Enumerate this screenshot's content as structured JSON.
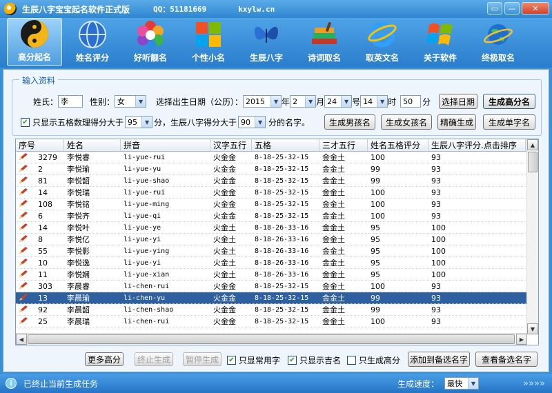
{
  "window": {
    "title": "生辰八字宝宝起名软件正式版",
    "qq": "QQ：51181669",
    "site": "kxylw.cn"
  },
  "toolbar": [
    {
      "label": "高分起名",
      "icon": "yin-yang-icon",
      "active": true
    },
    {
      "label": "姓名评分",
      "icon": "globe-icon"
    },
    {
      "label": "好听靓名",
      "icon": "hexagon-flower-icon"
    },
    {
      "label": "个性小名",
      "icon": "windows-logo-icon"
    },
    {
      "label": "生辰八字",
      "icon": "butterfly-icon"
    },
    {
      "label": "诗词取名",
      "icon": "books-icon"
    },
    {
      "label": "取英文名",
      "icon": "ie-globe-icon"
    },
    {
      "label": "关于软件",
      "icon": "vista-logo-icon"
    },
    {
      "label": "终极取名",
      "icon": "earth-orbit-icon"
    }
  ],
  "form": {
    "group_title": "输入资料",
    "surname_label": "姓氏：",
    "surname_value": "李",
    "gender_label": "性别：",
    "gender_value": "女",
    "date_label": "选择出生日期（公历）：",
    "year": "2015",
    "year_unit": "年",
    "month": "2",
    "month_unit": "月",
    "day": "24",
    "day_unit": "号",
    "hour": "14",
    "hour_unit": "时",
    "minute": "50",
    "minute_unit": "分",
    "pick_date_btn": "选择日期",
    "gen_high_btn": "生成高分名",
    "filter_label1": "只显示五格数理得分大于",
    "wuge_min": "95",
    "filter_label2": "分，生辰八字得分大于",
    "bazi_min": "90",
    "filter_label3": "分的名字。",
    "boy_btn": "生成男孩名",
    "girl_btn": "生成女孩名",
    "precise_btn": "精确生成",
    "single_btn": "生成单字名"
  },
  "table": {
    "columns": [
      "序号",
      "姓名",
      "拼音",
      "汉字五行",
      "五格",
      "三才五行",
      "姓名五格评分",
      "生辰八字评分.点击排序"
    ],
    "rows": [
      [
        "3279",
        "李悦睿",
        "li-yue-rui",
        "火金金",
        "8-18-25-32-15",
        "金金土",
        "100",
        "93"
      ],
      [
        "2",
        "李悦瑜",
        "li-yue-yu",
        "火金金",
        "8-18-25-32-15",
        "金金土",
        "99",
        "93"
      ],
      [
        "81",
        "李悦韶",
        "li-yue-shao",
        "火金金",
        "8-18-25-32-15",
        "金金土",
        "99",
        "93"
      ],
      [
        "14",
        "李悦瑞",
        "li-yue-rui",
        "火金金",
        "8-18-25-32-15",
        "金金土",
        "100",
        "93"
      ],
      [
        "108",
        "李悦铭",
        "li-yue-ming",
        "火金金",
        "8-18-25-32-15",
        "金金土",
        "100",
        "93"
      ],
      [
        "6",
        "李悦齐",
        "li-yue-qi",
        "火金金",
        "8-18-25-32-15",
        "金金土",
        "100",
        "93"
      ],
      [
        "14",
        "李悦叶",
        "li-yue-ye",
        "火金土",
        "8-18-26-33-16",
        "金金土",
        "95",
        "100"
      ],
      [
        "8",
        "李悦亿",
        "li-yue-yi",
        "火金土",
        "8-18-26-33-16",
        "金金土",
        "95",
        "100"
      ],
      [
        "55",
        "李悦影",
        "li-yue-ying",
        "火金土",
        "8-18-26-33-16",
        "金金土",
        "95",
        "100"
      ],
      [
        "10",
        "李悦逸",
        "li-yue-yi",
        "火金土",
        "8-18-26-33-16",
        "金金土",
        "95",
        "100"
      ],
      [
        "11",
        "李悦娴",
        "li-yue-xian",
        "火金土",
        "8-18-26-33-16",
        "金金土",
        "95",
        "100"
      ],
      [
        "303",
        "李晨睿",
        "li-chen-rui",
        "火金金",
        "8-18-25-32-15",
        "金金土",
        "100",
        "93"
      ],
      [
        "13",
        "李晨瑜",
        "li-chen-yu",
        "火金金",
        "8-18-25-32-15",
        "金金土",
        "99",
        "93"
      ],
      [
        "92",
        "李晨韶",
        "li-chen-shao",
        "火金金",
        "8-18-25-32-15",
        "金金土",
        "99",
        "93"
      ],
      [
        "25",
        "李晨瑞",
        "li-chen-rui",
        "火金金",
        "8-18-25-32-15",
        "金金土",
        "100",
        "93"
      ]
    ],
    "selected_index": 12
  },
  "actions": {
    "more_high": "更多高分",
    "stop_gen": "终止生成",
    "pause_gen": "暂停生成",
    "common_only": "只显常用字",
    "lucky_only": "只显示吉名",
    "high_only": "只生成高分",
    "add_backup": "添加到备选名字",
    "view_backup": "查看备选名字"
  },
  "status": {
    "message": "已终止当前生成任务",
    "speed_label": "生成速度：",
    "speed_value": "最快",
    "chevrons": "»»»»"
  }
}
